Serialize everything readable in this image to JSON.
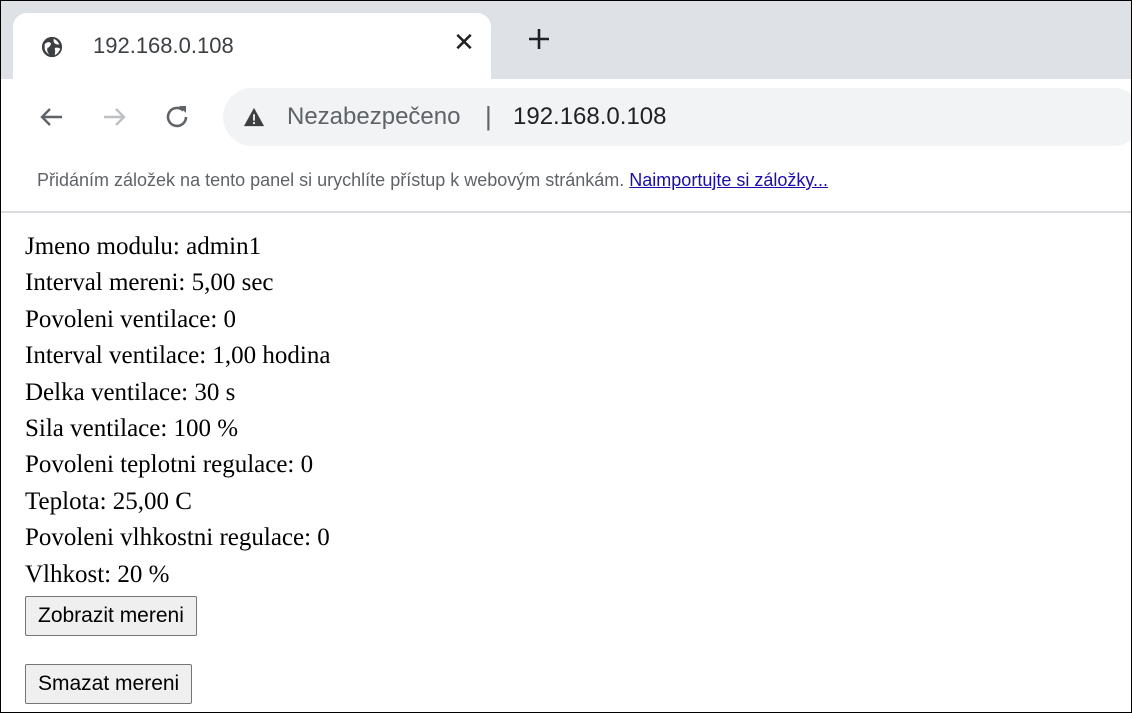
{
  "tab": {
    "title": "192.168.0.108",
    "favicon_icon": "globe-icon",
    "close_icon": "close-icon"
  },
  "toolbar": {
    "back_icon": "arrow-left-icon",
    "forward_icon": "arrow-right-icon",
    "reload_icon": "reload-icon",
    "security_icon": "warning-triangle-icon",
    "security_text": "Nezabezpečeno",
    "separator": "|",
    "url": "192.168.0.108"
  },
  "bookmarks": {
    "hint": "Přidáním záložek na tento panel si urychlíte přístup k webovým stránkám.",
    "import_link": "Naimportujte si záložky..."
  },
  "page": {
    "lines": [
      "Jmeno modulu: admin1",
      "Interval mereni: 5,00 sec",
      "Povoleni ventilace: 0",
      "Interval ventilace: 1,00 hodina",
      "Delka ventilace: 30 s",
      "Sila ventilace: 100 %",
      "Povoleni teplotni regulace: 0",
      "Teplota: 25,00 C",
      "Povoleni vlhkostni regulace: 0",
      "Vlhkost: 20 %"
    ],
    "show_button": "Zobrazit mereni",
    "delete_button": "Smazat mereni"
  },
  "colors": {
    "tabstrip_bg": "#dee1e6",
    "omnibox_bg": "#f1f3f4",
    "link": "#1a0dab"
  }
}
